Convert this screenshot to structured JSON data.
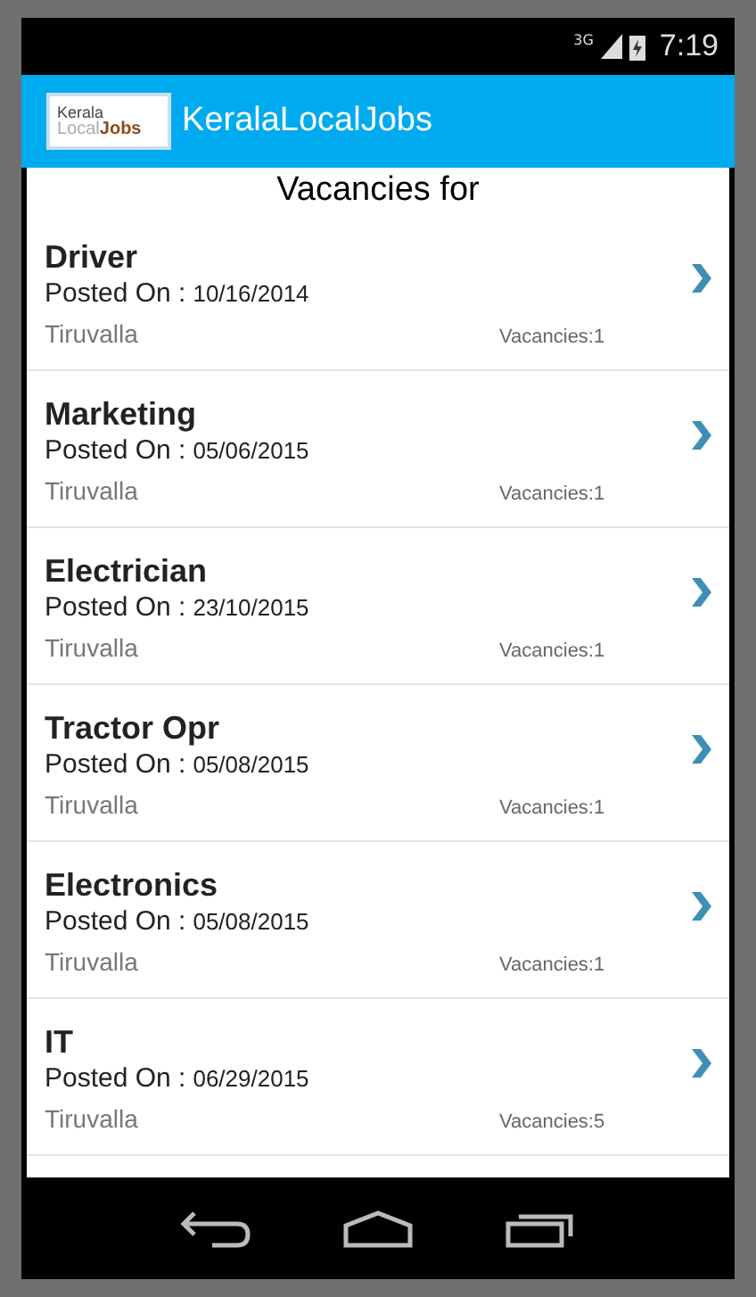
{
  "status_bar": {
    "network": "3G",
    "time": "7:19"
  },
  "app_bar": {
    "logo": {
      "line_1": "Kerala",
      "line_2a": "Local",
      "line_2b": "Jobs"
    },
    "title": "KeralaLocalJobs"
  },
  "heading": "Vacancies for",
  "jobs": [
    {
      "title": "Driver",
      "posted_label": "Posted On :",
      "date": "10/16/2014",
      "location": "Tiruvalla",
      "vacancies": "Vacancies:1"
    },
    {
      "title": "Marketing",
      "posted_label": "Posted On :",
      "date": "05/06/2015",
      "location": "Tiruvalla",
      "vacancies": "Vacancies:1"
    },
    {
      "title": "Electrician",
      "posted_label": "Posted On :",
      "date": "23/10/2015",
      "location": "Tiruvalla",
      "vacancies": "Vacancies:1"
    },
    {
      "title": "Tractor Opr",
      "posted_label": "Posted On :",
      "date": "05/08/2015",
      "location": "Tiruvalla",
      "vacancies": "Vacancies:1"
    },
    {
      "title": "Electronics",
      "posted_label": "Posted On :",
      "date": "05/08/2015",
      "location": "Tiruvalla",
      "vacancies": "Vacancies:1"
    },
    {
      "title": "IT",
      "posted_label": "Posted On :",
      "date": "06/29/2015",
      "location": "Tiruvalla",
      "vacancies": "Vacancies:5"
    }
  ]
}
